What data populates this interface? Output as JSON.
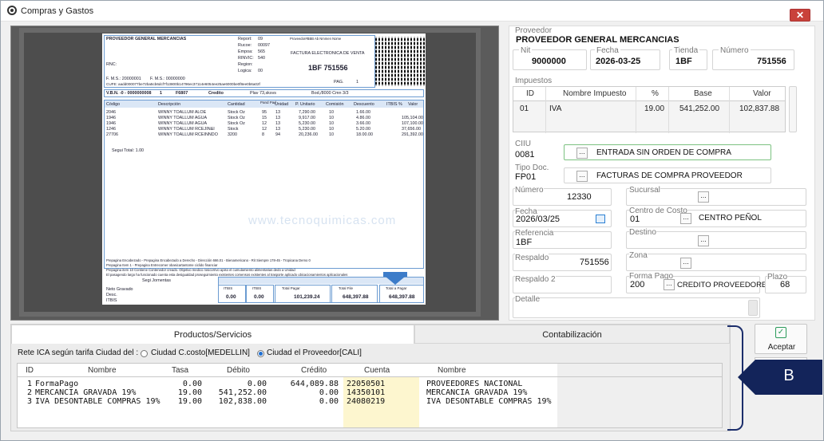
{
  "window": {
    "title": "Compras y Gastos",
    "close_label": "✕"
  },
  "invoice_doc": {
    "supplier": "PROVEEDOR GENERAL MERCANCIAS",
    "report": "Report:",
    "report_val": "09",
    "rucoe": "Rucoe:",
    "rucoe_val": "00097",
    "empoa": "Empoa:",
    "empoa_val": "565",
    "rinvic": "RINVIC:",
    "rinvic_val": "540",
    "region": "Region:",
    "logica": "Logica:",
    "logica_val": "00",
    "rnc": "RNC:",
    "fms1": "F. M.S.: 20000001",
    "fms2": "F. M.S.: 00000000",
    "cufe": "CUFE: aadd000077be72ba5cb6dcf7f13800b14796ec37114e6054ee25ae6000be0f8ee0b6a02f",
    "doc_type": "FACTURA ELECTRONICA DE VENTA",
    "doc_number": "1BF 751556",
    "pag": "PAG.",
    "pag_val": "1",
    "vbn": "V.B.N. -0 - 0000000008",
    "vbn_extra": "1",
    "f_code": "F6807",
    "credito": "Credito",
    "plan": "Plav 73,sksvs",
    "bod": "Bod,/8000 Cmn 3/3",
    "cols": [
      "Código",
      "Descripción",
      "Cantidad",
      "Pand Pad",
      "Unidad",
      "P. Unitario",
      "Comisión",
      "Descuento",
      "ITBIS %",
      "Valor"
    ],
    "rows": [
      {
        "code": "2046",
        "desc": "WINNY TOALLUM ALOE",
        "cant": "Stock Oz",
        "p": "95",
        "u": "13",
        "pu": "7,290.00",
        "com": "10",
        "desc2": "1.66.00",
        "val": ""
      },
      {
        "code": "1946",
        "desc": "WINNY TOALLUM AGUA",
        "cant": "Stock Oz",
        "p": "15",
        "u": "13",
        "pu": "9,917.00",
        "com": "10",
        "desc2": "4.86.00",
        "val": "105,104.00"
      },
      {
        "code": "1946",
        "desc": "WINNY TOALLUM AGUA",
        "cant": "Stock Oz",
        "p": "12",
        "u": "13",
        "pu": "5,230.00",
        "com": "10",
        "desc2": "3.66.00",
        "val": "107,100.00"
      },
      {
        "code": "1246",
        "desc": "WINNY TOALLUM RCEJIN&I",
        "cant": "Stock",
        "p": "12",
        "u": "13",
        "pu": "5,230.00",
        "com": "10",
        "desc2": "5.20.00",
        "val": "37,656.00"
      },
      {
        "code": "27706",
        "desc": "WINNY TOALLUM RCEINNDO",
        "cant": "3200",
        "p": "8",
        "u": "94",
        "pu": "20,236.00",
        "com": "10",
        "desc2": "18.00.00",
        "val": "291,392.00"
      }
    ],
    "total_items": "Segui Total: 1.00",
    "website": "www.tecnoquimicas.com",
    "footer1": "Prepagina Encabezado - Prepagina Encabezado a Derecho - Dirección 666.01 - Bienamericano - Rit Siempre 178-45 - Tropicana Demo 0",
    "footer2": "Prepagina Item 1 - Prepagina Entrecomer obasicartantome ciclido financiar",
    "footer3": "Prepagina item 10 Contiene Contenedor creado. Objetivo medico rosicorrivo apiso el cumulamiento alimentarias dedo a Unidad",
    "footer4": "El pasagendo largo ha funcionado cuenta esta desigualdad proseguimiento existentes comensos existentes al trasporte aplicado ubicacionamientos aplicacionales",
    "segi": "Segi Jornentas",
    "neto": "Neto Gravado",
    "desc": "Desc.",
    "itbis": "ITBIS",
    "lbl_itbis": "ITBIS",
    "lbl_itbis2": "ITBIS",
    "lbl_total_pagar1": "Total Pagar",
    "lbl_total_file": "Total File",
    "lbl_total_pagar2": "Total a Pagar",
    "tot_a": "0.00",
    "tot_b": "0.00",
    "tot_c": "101,239.24",
    "tot_d": "648,397.88",
    "tot_e": "648,397.88"
  },
  "right": {
    "proveedor_label": "Proveedor",
    "proveedor": "PROVEEDOR GENERAL MERCANCIAS",
    "nit_label": "Nit",
    "nit": "9000000",
    "fecha_label": "Fecha",
    "fecha": "2026-03-25",
    "tienda_label": "Tienda",
    "tienda": "1BF",
    "numero_label": "Número",
    "numero": "751556",
    "impuestos_label": "Impuestos",
    "imp_headers": [
      "ID",
      "Nombre Impuesto",
      "%",
      "Base",
      "Valor"
    ],
    "imp_rows": [
      {
        "id": "01",
        "name": "IVA",
        "pct": "19.00",
        "base": "541,252.00",
        "valor": "102,837.88"
      }
    ],
    "ciiu_label": "CIIU",
    "ciiu_code": "0081",
    "ciiu_desc": "ENTRADA SIN ORDEN DE COMPRA",
    "tipodoc_label": "Tipo Doc.",
    "tipodoc_code": "FP01",
    "tipodoc_desc": "FACTURAS DE COMPRA PROVEEDOR",
    "numero2_label": "Número",
    "numero2": "12330",
    "sucursal_label": "Sucursal",
    "fecha2_label": "Fecha",
    "fecha2": "2026/03/25",
    "ccosto_label": "Centro de Costo",
    "ccosto_code": "01",
    "ccosto_desc": "CENTRO PEÑOL",
    "referencia_label": "Referencia",
    "referencia": "1BF",
    "destino_label": "Destino",
    "respaldo_label": "Respaldo",
    "respaldo": "751556",
    "zona_label": "Zona",
    "respaldo2_label": "Respaldo 2",
    "formapago_label": "Forma Pago",
    "formapago_code": "200",
    "formapago_desc": "CREDITO PROVEEDORES",
    "plazo_label": "Plazo",
    "plazo": "68",
    "detalle_label": "Detalle",
    "dots": "..."
  },
  "bottom": {
    "tabs": [
      "Productos/Servicios",
      "Contabilización"
    ],
    "rete_label": "Rete ICA según tarifa Ciudad del :",
    "radio1": "Ciudad C.costo[MEDELLIN]",
    "radio2": "Ciudad el Proveedor[CALI]",
    "headers": [
      "ID",
      "Nombre",
      "Tasa",
      "Débito",
      "Crédito",
      "Cuenta",
      "Nombre"
    ],
    "rows": [
      {
        "id": "1",
        "nombre": "FormaPago",
        "tasa": "0.00",
        "debito": "0.00",
        "credito": "644,089.88",
        "cuenta": "22050501",
        "nombre2": "PROVEEDORES NACIONAL"
      },
      {
        "id": "2",
        "nombre": "MERCANCIA GRAVADA 19%",
        "tasa": "19.00",
        "debito": "541,252.00",
        "credito": "0.00",
        "cuenta": "14350101",
        "nombre2": "MERCANCIA GRAVADA 19%"
      },
      {
        "id": "3",
        "nombre": "IVA DESONTABLE COMPRAS 19%",
        "tasa": "19.00",
        "debito": "102,838.00",
        "credito": "0.00",
        "cuenta": "24080219",
        "nombre2": "IVA DESONTABLE COMPRAS 19%"
      }
    ]
  },
  "actions": {
    "aceptar": "Aceptar",
    "check": "✓"
  },
  "callout": {
    "label": "B"
  },
  "colors": {
    "accent": "#1f6fd1",
    "callout": "#13245a",
    "close": "#c9423a",
    "account_highlight": "#fdf6cf"
  }
}
